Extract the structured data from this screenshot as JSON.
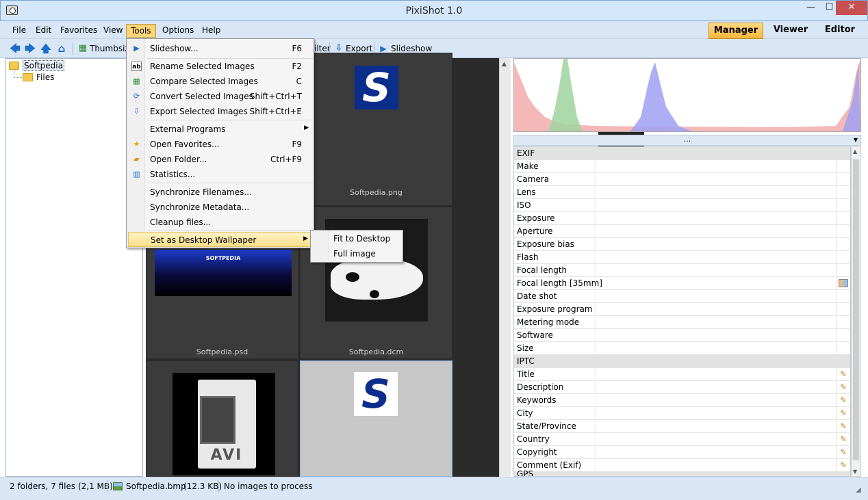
{
  "window": {
    "title": "PixiShot 1.0",
    "min_glyph": "—",
    "max_glyph": "☐",
    "close_glyph": "✕"
  },
  "menubar": {
    "items": [
      "File",
      "Edit",
      "Favorites",
      "View",
      "Tools",
      "Options",
      "Help"
    ],
    "active": "Tools",
    "modes": [
      "Manager",
      "Viewer",
      "Editor"
    ],
    "active_mode": "Manager"
  },
  "toolbar": {
    "thumbsize_label": "Thumbsiz",
    "filter_label": "ilter",
    "export_label": "Export",
    "slideshow_label": "Slideshow"
  },
  "tree": {
    "root": "Softpedia",
    "child": "Files"
  },
  "thumbnails": [
    {
      "name": "Softpedia.png",
      "logo": "S"
    },
    {
      "name": "Softpedia.psd",
      "banner": "SOFTPEDIA"
    },
    {
      "name": "Softpedia.dcm"
    },
    {
      "name": "",
      "video_label": "AVI"
    },
    {
      "name": "",
      "logo": "S"
    }
  ],
  "tools_menu": {
    "items": [
      {
        "label": "Slideshow...",
        "shortcut": "F6",
        "icon": "play-icon"
      },
      {
        "label": "Rename Selected Images",
        "shortcut": "F2",
        "icon": "rename-icon"
      },
      {
        "label": "Compare Selected Images",
        "shortcut": "C",
        "icon": "compare-icon"
      },
      {
        "label": "Convert Selected Images",
        "shortcut": "Shift+Ctrl+T",
        "icon": "convert-icon"
      },
      {
        "label": "Export Selected Images",
        "shortcut": "Shift+Ctrl+E",
        "icon": "export-icon"
      },
      {
        "label": "External Programs",
        "shortcut": "",
        "icon": ""
      },
      {
        "label": "Open Favorites...",
        "shortcut": "F9",
        "icon": "star-icon"
      },
      {
        "label": "Open Folder...",
        "shortcut": "Ctrl+F9",
        "icon": "folder-open-icon"
      },
      {
        "label": "Statistics...",
        "shortcut": "",
        "icon": "statistics-icon"
      },
      {
        "label": "Synchronize Filenames...",
        "shortcut": "",
        "icon": ""
      },
      {
        "label": "Synchronize Metadata...",
        "shortcut": "",
        "icon": ""
      },
      {
        "label": "Cleanup files...",
        "shortcut": "",
        "icon": ""
      },
      {
        "label": "Set as Desktop Wallpaper",
        "shortcut": "",
        "icon": ""
      }
    ],
    "submenu": [
      "Fit to Desktop",
      "Full image"
    ]
  },
  "histogram_bar": "...",
  "properties": {
    "groups": [
      {
        "name": "EXIF",
        "rows": [
          "Make",
          "Camera",
          "Lens",
          "ISO",
          "Exposure",
          "Aperture",
          "Exposure bias",
          "Flash",
          "Focal length",
          "Focal length [35mm]",
          "Date shot",
          "Exposure program",
          "Metering mode",
          "Software",
          "Size"
        ]
      },
      {
        "name": "IPTC",
        "rows": [
          "Title",
          "Description",
          "Keywords",
          "City",
          "State/Province",
          "Country",
          "Copyright",
          "Comment (Exif)"
        ]
      }
    ],
    "partial_group": "GPS"
  },
  "statusbar": {
    "counts": "2 folders,  7 files  (2,1 MB)",
    "file": "Softpedia.bmp",
    "size": "(12.3 KB)",
    "message": "No images to process"
  }
}
